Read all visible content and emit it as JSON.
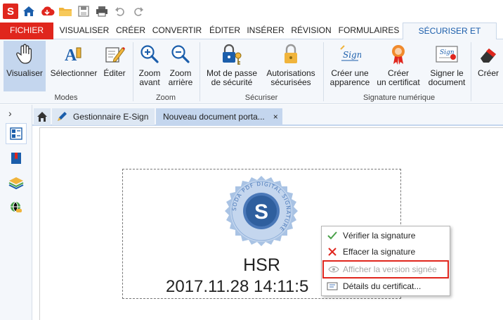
{
  "app": {
    "logo_letter": "S",
    "accent_color": "#e0261d",
    "ribbon_blue": "#1b5eab"
  },
  "quick_access": {
    "icons": [
      "app-logo-icon",
      "home-icon",
      "cloud-icon",
      "folder-icon",
      "save-icon",
      "print-icon",
      "undo-icon",
      "redo-icon"
    ]
  },
  "menu": {
    "tabs": [
      "FICHIER",
      "VISUALISER",
      "CRÉER",
      "CONVERTIR",
      "ÉDITER",
      "INSÉRER",
      "RÉVISION",
      "FORMULAIRES",
      "SÉCURISER ET SIGNER"
    ],
    "active": "SÉCURISER ET SIGNER"
  },
  "ribbon": {
    "modes": {
      "label": "Modes",
      "visualiser": "Visualiser",
      "selectionner": "Sélectionner",
      "editer": "Éditer"
    },
    "zoom": {
      "label": "Zoom",
      "zoom_in_1": "Zoom",
      "zoom_in_2": "avant",
      "zoom_out_1": "Zoom",
      "zoom_out_2": "arrière"
    },
    "securiser": {
      "label": "Sécuriser",
      "password_1": "Mot de passe",
      "password_2": "de sécurité",
      "permissions_1": "Autorisations",
      "permissions_2": "sécurisées"
    },
    "signature": {
      "label": "Signature numérique",
      "appearance_1": "Créer une",
      "appearance_2": "apparence",
      "certificate_1": "Créer",
      "certificate_2": "un certificat",
      "sign_1": "Signer le",
      "sign_2": "document"
    },
    "extra": {
      "create": "Créer"
    }
  },
  "left_panel": {
    "expand": "›"
  },
  "doc_tabs": {
    "esign": "Gestionnaire E-Sign",
    "new_doc": "Nouveau document porta...",
    "close": "×"
  },
  "signature": {
    "seal_letter": "S",
    "seal_text": "SODA PDF DIGITAL SIGNATURE",
    "name": "HSR",
    "date": "2017.11.28 14:11:5"
  },
  "context_menu": {
    "items": [
      {
        "label": "Vérifier la signature",
        "enabled": true
      },
      {
        "label": "Effacer la signature",
        "enabled": true
      },
      {
        "label": "Afficher la version signée",
        "enabled": false,
        "highlighted": true
      },
      {
        "label": "Détails du certificat...",
        "enabled": true
      }
    ]
  }
}
